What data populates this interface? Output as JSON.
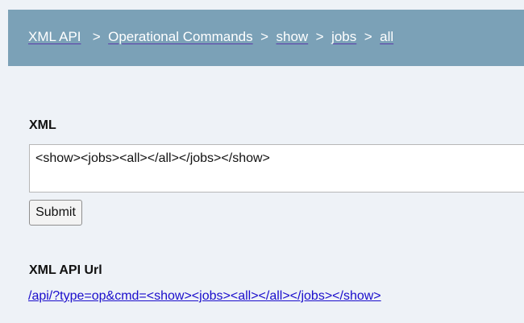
{
  "breadcrumb": {
    "items": [
      {
        "label": "XML API"
      },
      {
        "label": "Operational Commands"
      },
      {
        "label": "show"
      },
      {
        "label": "jobs"
      },
      {
        "label": "all"
      }
    ],
    "separator": ">"
  },
  "form": {
    "xml_label": "XML",
    "xml_value": "<show><jobs><all></all></jobs></show>",
    "submit_label": "Submit",
    "url_label": "XML API Url",
    "url_value": "/api/?type=op&cmd=<show><jobs><all></all></jobs></show>"
  },
  "colors": {
    "header_bg": "#7ba1b7",
    "page_bg": "#eef2f7",
    "link": "#1a0dcc"
  }
}
